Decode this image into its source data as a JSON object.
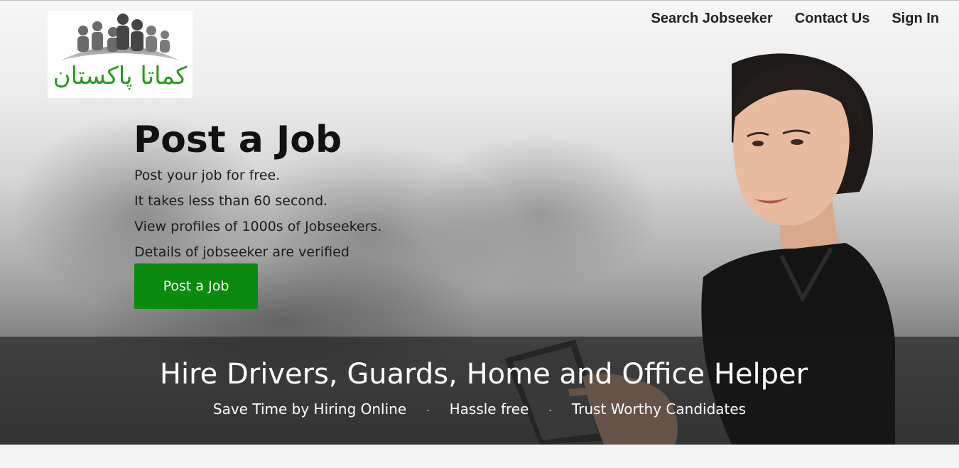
{
  "logo": {
    "text": "کماتا پاکستان",
    "color": "#2a9a1e"
  },
  "nav": {
    "items": [
      {
        "label": "Search Jobseeker"
      },
      {
        "label": "Contact Us"
      },
      {
        "label": "Sign In"
      }
    ]
  },
  "hero": {
    "title": "Post a Job",
    "lines": [
      "Post your job for free.",
      "It takes less than 60 second.",
      "View profiles of 1000s of Jobseekers.",
      "Details of jobseeker are verified"
    ],
    "button_label": "Post a Job",
    "button_color": "#0a8a0f"
  },
  "band": {
    "title": "Hire Drivers, Guards, Home and Office Helper",
    "points": [
      "Save Time by Hiring Online",
      "Hassle free",
      "Trust Worthy Candidates"
    ],
    "separator": "·"
  }
}
